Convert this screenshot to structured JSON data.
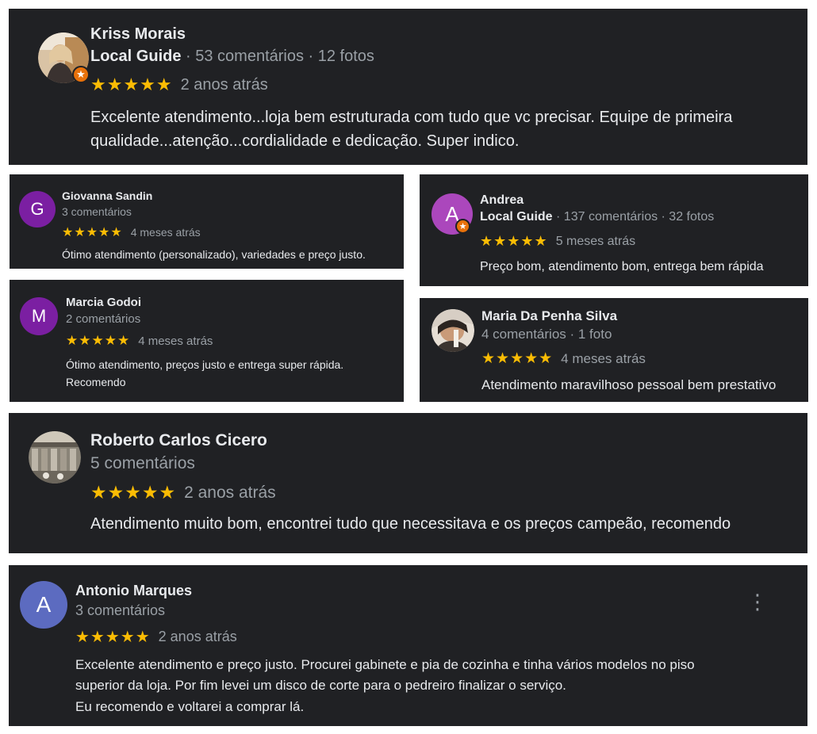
{
  "reviews": [
    {
      "name": "Kriss Morais",
      "guide": "Local Guide",
      "meta": " · 53 comentários · 12 fotos",
      "stars": "★★★★★",
      "when": "2 anos atrás",
      "text": "Excelente atendimento...loja bem estruturada com tudo que vc precisar. Equipe de primeira qualidade...atenção...cordialidade e dedicação. Super indico."
    },
    {
      "name": "Giovanna Sandin",
      "initial": "G",
      "meta": "3 comentários",
      "stars": "★★★★★",
      "when": "4 meses atrás",
      "text": "Ótimo atendimento (personalizado), variedades e preço justo.",
      "avatar_color": "#7b1fa2"
    },
    {
      "name": "Andrea",
      "initial": "A",
      "guide": "Local Guide",
      "meta": " · 137 comentários · 32 fotos",
      "stars": "★★★★★",
      "when": "5 meses atrás",
      "text": "Preço bom, atendimento bom, entrega bem rápida",
      "avatar_color": "#ab47bc"
    },
    {
      "name": "Marcia Godoi",
      "initial": "M",
      "meta": "2 comentários",
      "stars": "★★★★★",
      "when": "4 meses atrás",
      "text": "Ótimo atendimento, preços justo e entrega super rápida. Recomendo",
      "avatar_color": "#7b1fa2"
    },
    {
      "name": "Maria Da Penha Silva",
      "meta": "4 comentários · 1 foto",
      "stars": "★★★★★",
      "when": "4 meses atrás",
      "text": "Atendimento maravilhoso pessoal bem prestativo"
    },
    {
      "name": "Roberto Carlos Cicero",
      "meta": "5 comentários",
      "stars": "★★★★★",
      "when": "2 anos atrás",
      "text": "Atendimento muito bom, encontrei tudo que necessitava e os preços campeão, recomendo"
    },
    {
      "name": "Antonio Marques",
      "initial": "A",
      "meta": "3 comentários",
      "stars": "★★★★★",
      "when": "2 anos atrás",
      "text_lines": [
        "Excelente atendimento e preço justo. Procurei gabinete e pia de cozinha e tinha vários modelos no piso",
        "superior da loja. Por fim levei um disco de corte para o pedreiro finalizar o serviço.",
        "Eu recomendo e voltarei a comprar lá."
      ],
      "avatar_color": "#5c6bc0",
      "more_icon": "⋮"
    }
  ],
  "icons": {
    "local_guide_badge": "star-badge-icon"
  },
  "colors": {
    "card_bg": "#202124",
    "star": "#fbbc04",
    "badge": "#e8710a"
  }
}
